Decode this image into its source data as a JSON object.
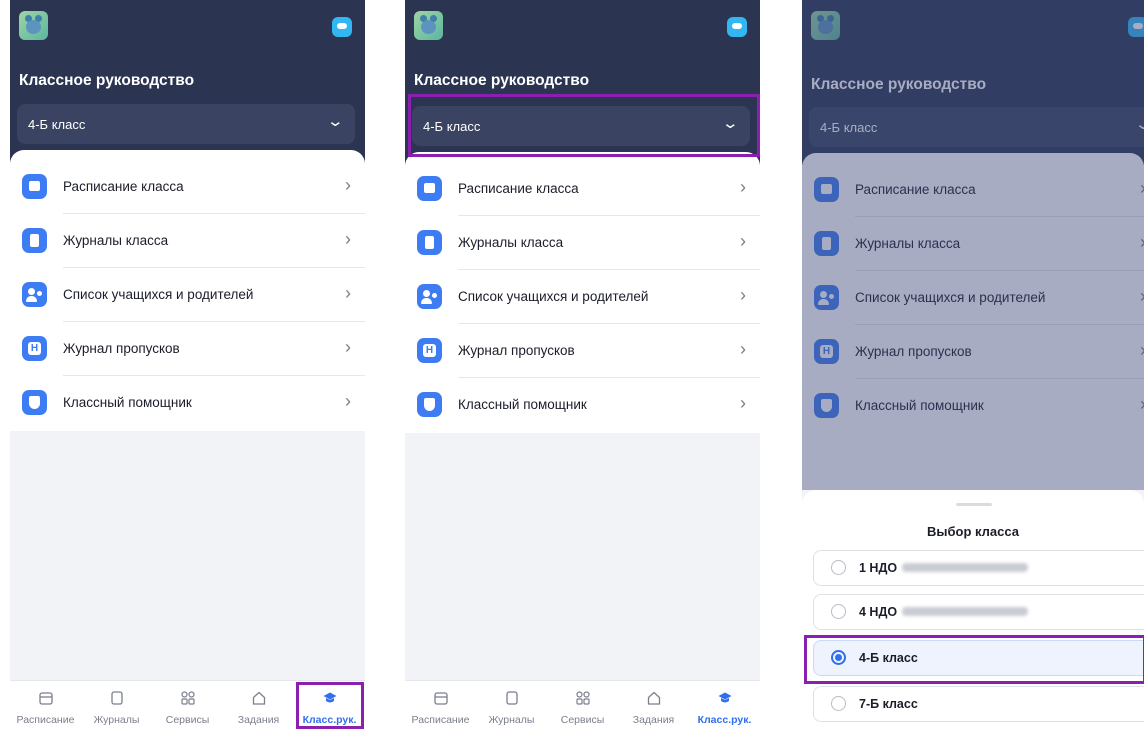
{
  "screens": [
    {
      "header_title": "Классное руководство",
      "selected_class": "4-Б класс"
    },
    {
      "header_title": "Классное руководство",
      "selected_class": "4-Б класс"
    },
    {
      "header_title": "Классное руководство",
      "selected_class": "4-Б класс"
    }
  ],
  "menu_items": [
    {
      "label": "Расписание класса",
      "icon": "calendar-icon"
    },
    {
      "label": "Журналы класса",
      "icon": "journal-icon"
    },
    {
      "label": "Список учащихся и родителей",
      "icon": "people-icon"
    },
    {
      "label": "Журнал пропусков",
      "icon": "absence-h-icon"
    },
    {
      "label": "Классный помощник",
      "icon": "shield-icon"
    }
  ],
  "tabs": [
    {
      "label": "Расписание",
      "icon": "calendar-icon"
    },
    {
      "label": "Журналы",
      "icon": "book-icon"
    },
    {
      "label": "Сервисы",
      "icon": "grid-icon"
    },
    {
      "label": "Задания",
      "icon": "home-icon"
    },
    {
      "label": "Класс.рук.",
      "icon": "graduation-cap-icon",
      "active": true
    }
  ],
  "class_picker": {
    "title": "Выбор класса",
    "options": [
      {
        "label": "1 НДО",
        "selected": false
      },
      {
        "label": "4 НДО",
        "selected": false
      },
      {
        "label": "4-Б класс",
        "selected": true
      },
      {
        "label": "7-Б класс",
        "selected": false
      }
    ]
  },
  "colors": {
    "header": "#2b3552",
    "accent": "#2f6ff0",
    "highlight": "#8a1fb0"
  }
}
